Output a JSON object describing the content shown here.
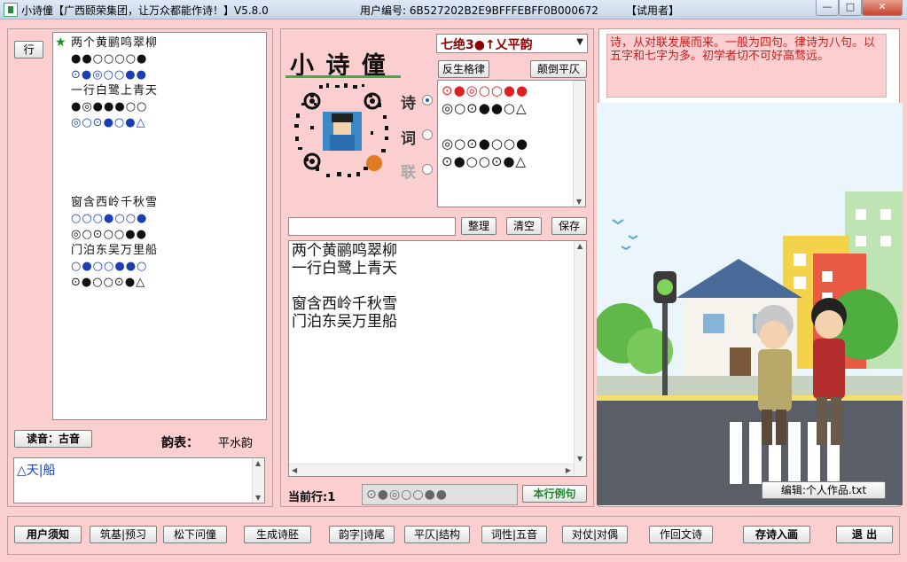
{
  "window": {
    "title": "小诗僮【广西颐荣集团，让万众都能作诗！】V5.8.0",
    "user_id": "用户编号: 6B527202B2E9BFFFEBFF0B000672",
    "trial": "【试用者】",
    "controls": {
      "minimize": "—",
      "maximize": "□",
      "close": "✕"
    }
  },
  "left": {
    "row_button": "行",
    "star": "★",
    "poem_lines": [
      "两个黄鹂鸣翠柳",
      "●●○○○○●",
      "⊙●◎○○●●",
      "一行白鹭上青天",
      "●◎●●●○○",
      "◎○⊙●○●△",
      "",
      "",
      "",
      "",
      "窗含西岭千秋雪",
      "○○○●○○●",
      "◎○⊙○○●●",
      "门泊东吴万里船",
      "○●○○●●○",
      "⊙●○○⊙●△"
    ],
    "reading_button": "读音：古音",
    "rhyme_table_label": "韵表：",
    "rhyme_table_value": "平水韵",
    "rhyme_box_text": "△天|船"
  },
  "center": {
    "logo_text": "小 诗 僮",
    "modes": [
      "诗",
      "词",
      "联"
    ],
    "selected_mode": "诗",
    "form_select": "七绝3●↑乂平韵",
    "btn_reverse": "反生格律",
    "btn_swap": "颠倒平仄",
    "pattern_lines": [
      "⊙●◎○○●●",
      "◎○⊙●●○△",
      "",
      "◎○⊙●○○●",
      "⊙●○○⊙●△"
    ],
    "input_placeholder": "",
    "btn_tidy": "整理",
    "btn_clear": "清空",
    "btn_save": "保存",
    "editor_text": "两个黄鹂鸣翠柳\n一行白鹭上青天\n\n窗含西岭千秋雪\n门泊东吴万里船",
    "current_row_label": "当前行:1",
    "current_row_pattern": "⊙●◎○○●●",
    "btn_example": "本行例句"
  },
  "right": {
    "tip_text": "诗，从对联发展而来。一般为四句。律诗为八句。以五字和七字为多。初学者切不可好高骛远。",
    "edit_file_button": "编辑:个人作品.txt"
  },
  "bottom": {
    "buttons": [
      "用户须知",
      "筑基|预习",
      "松下问僮",
      "生成诗胚",
      "韵字|诗尾",
      "平仄|结构",
      "词性|五音",
      "对仗|对偶",
      "作回文诗",
      "存诗入画",
      "退 出"
    ]
  },
  "colors": {
    "background": "#fbcfcf",
    "accent_green": "#3cb043",
    "dark_red": "#8b0000",
    "tip_red": "#c81e1e"
  }
}
